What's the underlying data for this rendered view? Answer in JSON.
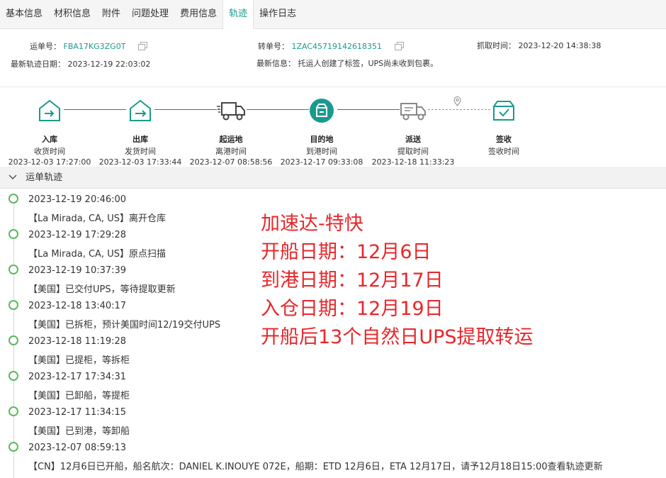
{
  "tabs": [
    "基本信息",
    "材积信息",
    "附件",
    "问题处理",
    "费用信息",
    "轨迹",
    "操作日志"
  ],
  "active_tab": 5,
  "info": {
    "waybill_label": "运单号：",
    "waybill_value": "FBA17KG3ZG0T",
    "transfer_label": "转单号：",
    "transfer_value": "1ZAC45719142618351",
    "fetch_label": "抓取时间：",
    "fetch_value": "2023-12-20 14:38:38",
    "latest_date_label": "最新轨迹日期：",
    "latest_date_value": "2023-12-19 22:03:02",
    "latest_info_label": "最新信息：",
    "latest_info_value": "托运人创建了标签，UPS尚未收到包裹。"
  },
  "steps": [
    {
      "name": "入库",
      "sub": "收货时间",
      "time": "2023-12-03 17:27:00",
      "icon": "warehouse-in-icon"
    },
    {
      "name": "出库",
      "sub": "发货时间",
      "time": "2023-12-03 17:33:44",
      "icon": "warehouse-out-icon"
    },
    {
      "name": "起运地",
      "sub": "离港时间",
      "time": "2023-12-07 08:58:56",
      "icon": "truck-icon"
    },
    {
      "name": "目的地",
      "sub": "到港时间",
      "time": "2023-12-17 09:33:08",
      "icon": "destination-icon"
    },
    {
      "name": "派送",
      "sub": "提取时间",
      "time": "2023-12-18 11:33:23",
      "icon": "delivery-truck-icon"
    },
    {
      "name": "签收",
      "sub": "签收时间",
      "time": "",
      "icon": "signed-box-icon"
    }
  ],
  "section_title": "运单轨迹",
  "events": [
    {
      "time": "2023-12-19 20:46:00",
      "desc": "【La Mirada, CA, US】离开仓库"
    },
    {
      "time": "2023-12-19 17:29:28",
      "desc": "【La Mirada, CA, US】原点扫描"
    },
    {
      "time": "2023-12-19 10:37:39",
      "desc": "【美国】已交付UPS，等待提取更新"
    },
    {
      "time": "2023-12-18 13:40:17",
      "desc": "【美国】已拆柜，预计美国时间12/19交付UPS"
    },
    {
      "time": "2023-12-18 11:19:28",
      "desc": "【美国】已提柜，等拆柜"
    },
    {
      "time": "2023-12-17 17:34:31",
      "desc": "【美国】已卸船，等提柜"
    },
    {
      "time": "2023-12-17 11:34:15",
      "desc": "【美国】已到港，等卸船"
    },
    {
      "time": "2023-12-07 08:59:13",
      "desc": "【CN】12月6日已开船，船名航次：DANIEL K.INOUYE 072E，船期：ETD 12月6日，ETA 12月17日，请予12月18日15:00查看轨迹更新"
    }
  ],
  "note_lines": [
    "加速达-特快",
    "开船日期：12月6日",
    "到港日期：12月17日",
    "入仓日期：12月19日",
    "开船后13个自然日UPS提取转运"
  ],
  "colors": {
    "accent": "#1a9a8e",
    "timeline_dot": "#5cb85c",
    "note": "#e8262a"
  }
}
